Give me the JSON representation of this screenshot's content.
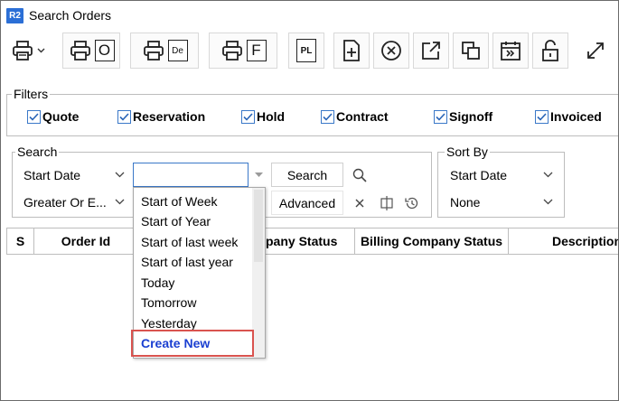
{
  "window": {
    "logo": "R2",
    "title": "Search Orders"
  },
  "toolbar": {
    "buttons": [
      {
        "name": "print-menu",
        "icon": "printer-icon"
      },
      {
        "name": "print-o",
        "letter": "O"
      },
      {
        "name": "print-de",
        "letter": "De"
      },
      {
        "name": "print-f",
        "letter": "F"
      },
      {
        "name": "pl",
        "letter": "PL"
      },
      {
        "name": "new",
        "icon": "new-document-icon"
      },
      {
        "name": "cancel",
        "icon": "cancel-circle-icon"
      },
      {
        "name": "open",
        "icon": "open-external-icon"
      },
      {
        "name": "copy",
        "icon": "copy-icon"
      },
      {
        "name": "calendar",
        "icon": "calendar-forward-icon"
      },
      {
        "name": "unlock",
        "icon": "unlock-icon"
      },
      {
        "name": "expand",
        "icon": "expand-icon"
      }
    ]
  },
  "filters": {
    "label": "Filters",
    "items": [
      {
        "label": "Quote",
        "checked": true
      },
      {
        "label": "Reservation",
        "checked": true
      },
      {
        "label": "Hold",
        "checked": true
      },
      {
        "label": "Contract",
        "checked": true
      },
      {
        "label": "Signoff",
        "checked": true
      },
      {
        "label": "Invoiced",
        "checked": true
      }
    ]
  },
  "search": {
    "label": "Search",
    "field": "Start Date",
    "operator": "Greater Or E...",
    "value": "",
    "search_button": "Search",
    "advanced_button": "Advanced"
  },
  "sort": {
    "label": "Sort By",
    "field": "Start Date",
    "order": "None"
  },
  "grid": {
    "columns": [
      "S",
      "Order Id",
      "",
      "pany Status",
      "Billing Company Status",
      "Description"
    ]
  },
  "dropdown": {
    "options": [
      "Start of Week",
      "Start of Year",
      "Start of last week",
      "Start of last year",
      "Today",
      "Tomorrow",
      "Yesterday",
      "Create New"
    ]
  },
  "colors": {
    "accent": "#3a78c8",
    "highlight": "#d9534f",
    "link": "#1a3fd1"
  }
}
